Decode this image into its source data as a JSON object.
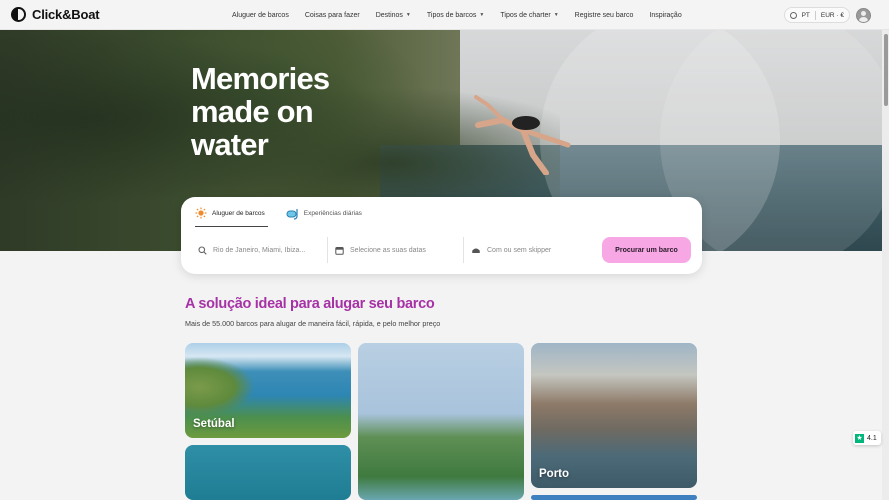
{
  "header": {
    "logo_text": "Click&Boat",
    "nav": [
      {
        "label": "Aluguer de barcos",
        "dropdown": false
      },
      {
        "label": "Coisas para fazer",
        "dropdown": false
      },
      {
        "label": "Destinos",
        "dropdown": true
      },
      {
        "label": "Tipos de barcos",
        "dropdown": true
      },
      {
        "label": "Tipos de charter",
        "dropdown": true
      },
      {
        "label": "Registre seu barco",
        "dropdown": false
      },
      {
        "label": "Inspiração",
        "dropdown": false
      }
    ],
    "language": "PT",
    "currency": "EUR · €"
  },
  "hero": {
    "title": "Memories made on water"
  },
  "search": {
    "tabs": [
      {
        "label": "Aluguer de barcos",
        "icon": "sun-icon",
        "active": true
      },
      {
        "label": "Experiências diárias",
        "icon": "snorkel-icon",
        "active": false
      }
    ],
    "location_placeholder": "Rio de Janeiro, Miami, Ibiza...",
    "dates_placeholder": "Selecione as suas datas",
    "skipper_placeholder": "Com ou sem skipper",
    "button_label": "Procurar um barco",
    "button_color": "#f7a8e4"
  },
  "section": {
    "title": "A solução ideal para alugar seu barco",
    "subtitle": "Mais de 55.000 barcos para alugar de maneira fácil, rápida, e pelo melhor preço",
    "title_color": "#a632a6"
  },
  "destinations": [
    {
      "name": "Setúbal"
    },
    {
      "name": ""
    },
    {
      "name": "Porto"
    }
  ],
  "rating": {
    "value": "4.1",
    "star_color": "#00b67a"
  }
}
